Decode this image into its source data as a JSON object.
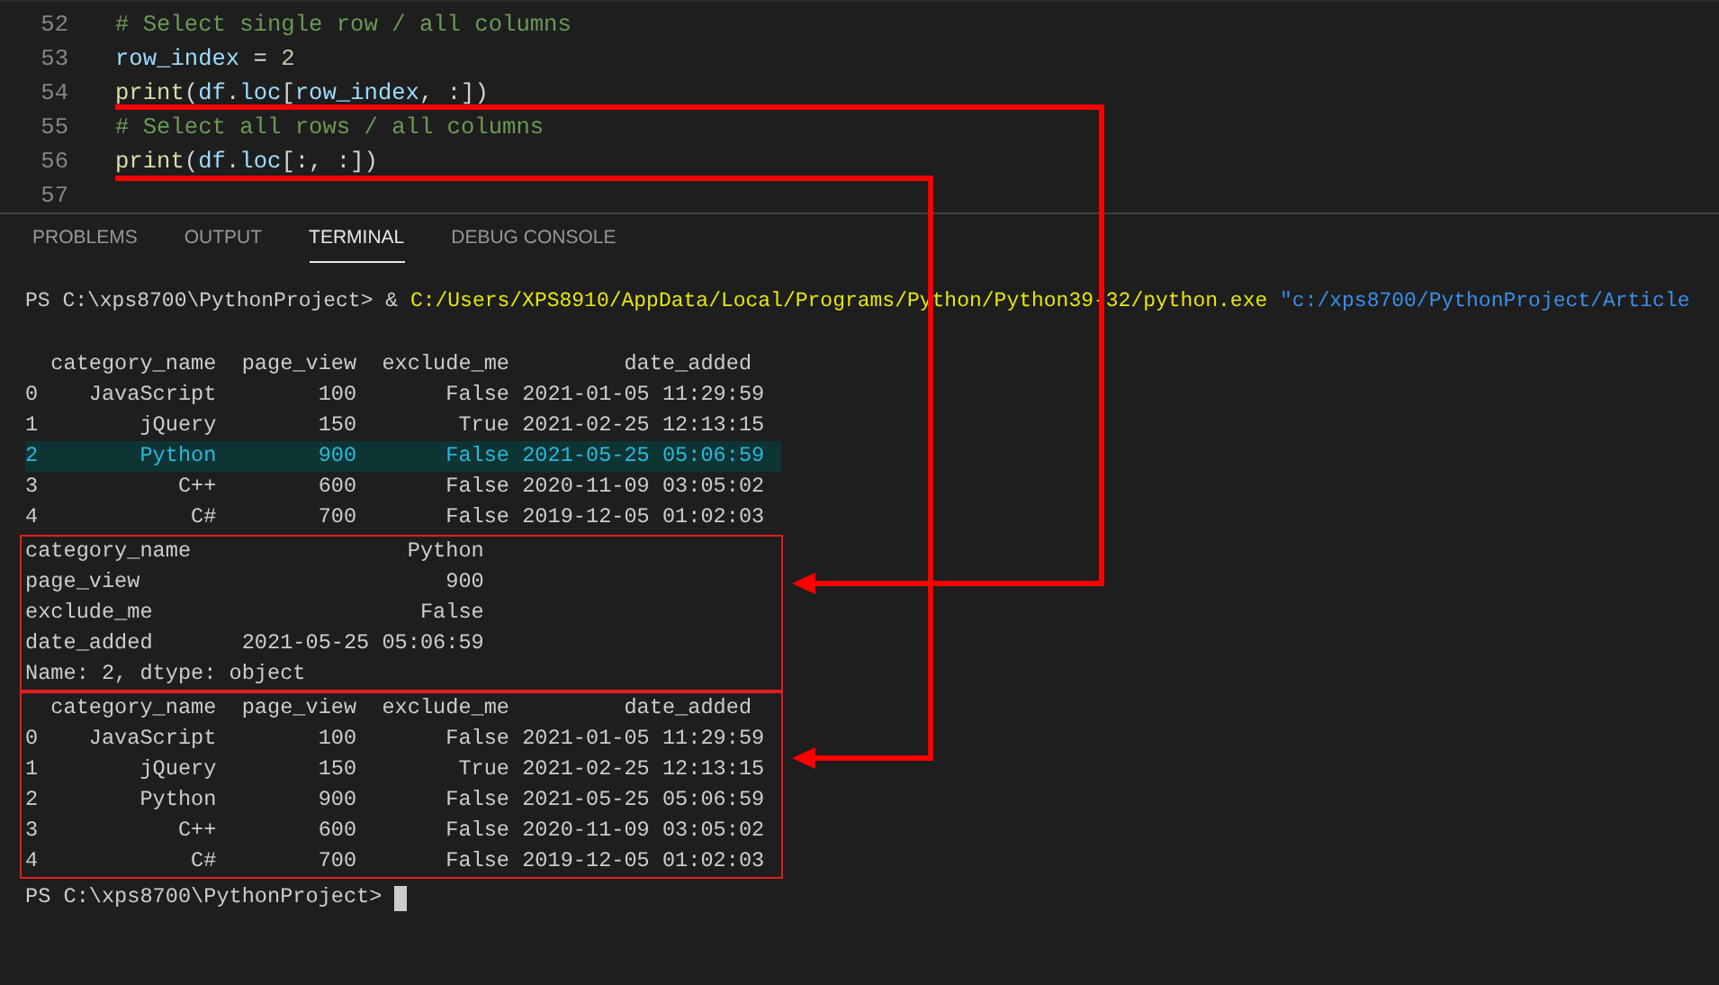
{
  "editor": {
    "lines": [
      {
        "number": "52",
        "tokens": [
          {
            "text": "# Select single row / all columns",
            "kind": "comment"
          }
        ]
      },
      {
        "number": "53",
        "tokens": [
          {
            "text": "row_index",
            "kind": "variable"
          },
          {
            "text": " = ",
            "kind": "plain"
          },
          {
            "text": "2",
            "kind": "number"
          }
        ]
      },
      {
        "number": "54",
        "tokens": [
          {
            "text": "print",
            "kind": "function"
          },
          {
            "text": "(",
            "kind": "plain"
          },
          {
            "text": "df",
            "kind": "variable"
          },
          {
            "text": ".",
            "kind": "plain"
          },
          {
            "text": "loc",
            "kind": "variable"
          },
          {
            "text": "[",
            "kind": "plain"
          },
          {
            "text": "row_index",
            "kind": "variable"
          },
          {
            "text": ", :])",
            "kind": "plain"
          }
        ]
      },
      {
        "number": "55",
        "tokens": [
          {
            "text": "# Select all rows / all columns",
            "kind": "comment"
          }
        ]
      },
      {
        "number": "56",
        "tokens": [
          {
            "text": "print",
            "kind": "function"
          },
          {
            "text": "(",
            "kind": "plain"
          },
          {
            "text": "df",
            "kind": "variable"
          },
          {
            "text": ".",
            "kind": "plain"
          },
          {
            "text": "loc",
            "kind": "variable"
          },
          {
            "text": "[:, :])",
            "kind": "plain"
          }
        ]
      },
      {
        "number": "57"
      }
    ]
  },
  "panel": {
    "tabs": [
      {
        "label": "PROBLEMS",
        "selected": false
      },
      {
        "label": "OUTPUT",
        "selected": false
      },
      {
        "label": "TERMINAL",
        "selected": true
      },
      {
        "label": "DEBUG CONSOLE",
        "selected": false
      }
    ]
  },
  "terminal": {
    "command": [
      {
        "text": "PS C:\\xps8700\\PythonProject> & ",
        "kind": "prompt"
      },
      {
        "text": "C:/Users/XPS8910/AppData/Local/Programs/Python/Python39-32/python.exe",
        "kind": "path"
      },
      {
        "text": "\"c:/xps8700/PythonProject/Article",
        "kind": "string"
      }
    ],
    "blocks": [
      {
        "outlined": false,
        "lines": [
          {
            "text": "  category_name  page_view  exclude_me         date_added",
            "highlighted": false
          },
          {
            "text": "0    JavaScript        100       False 2021-01-05 11:29:59",
            "highlighted": false
          },
          {
            "text": "1        jQuery        150        True 2021-02-25 12:13:15",
            "highlighted": false
          },
          {
            "text": "2        Python        900       False 2021-05-25 05:06:59",
            "highlighted": true
          },
          {
            "text": "3           C++        600       False 2020-11-09 03:05:02",
            "highlighted": false
          },
          {
            "text": "4            C#        700       False 2019-12-05 01:02:03",
            "highlighted": false
          }
        ]
      },
      {
        "outlined": true,
        "lines": [
          {
            "text": "category_name                 Python",
            "highlighted": false
          },
          {
            "text": "page_view                        900",
            "highlighted": false
          },
          {
            "text": "exclude_me                     False",
            "highlighted": false
          },
          {
            "text": "date_added       2021-05-25 05:06:59",
            "highlighted": false
          },
          {
            "text": "Name: 2, dtype: object",
            "highlighted": false
          }
        ]
      },
      {
        "outlined": true,
        "lines": [
          {
            "text": "  category_name  page_view  exclude_me         date_added",
            "highlighted": false
          },
          {
            "text": "0    JavaScript        100       False 2021-01-05 11:29:59",
            "highlighted": false
          },
          {
            "text": "1        jQuery        150        True 2021-02-25 12:13:15",
            "highlighted": false
          },
          {
            "text": "2        Python        900       False 2021-05-25 05:06:59",
            "highlighted": false
          },
          {
            "text": "3           C++        600       False 2020-11-09 03:05:02",
            "highlighted": false
          },
          {
            "text": "4            C#        700       False 2019-12-05 01:02:03",
            "highlighted": false
          }
        ]
      }
    ],
    "prompt": "PS C:\\xps8700\\PythonProject>"
  }
}
